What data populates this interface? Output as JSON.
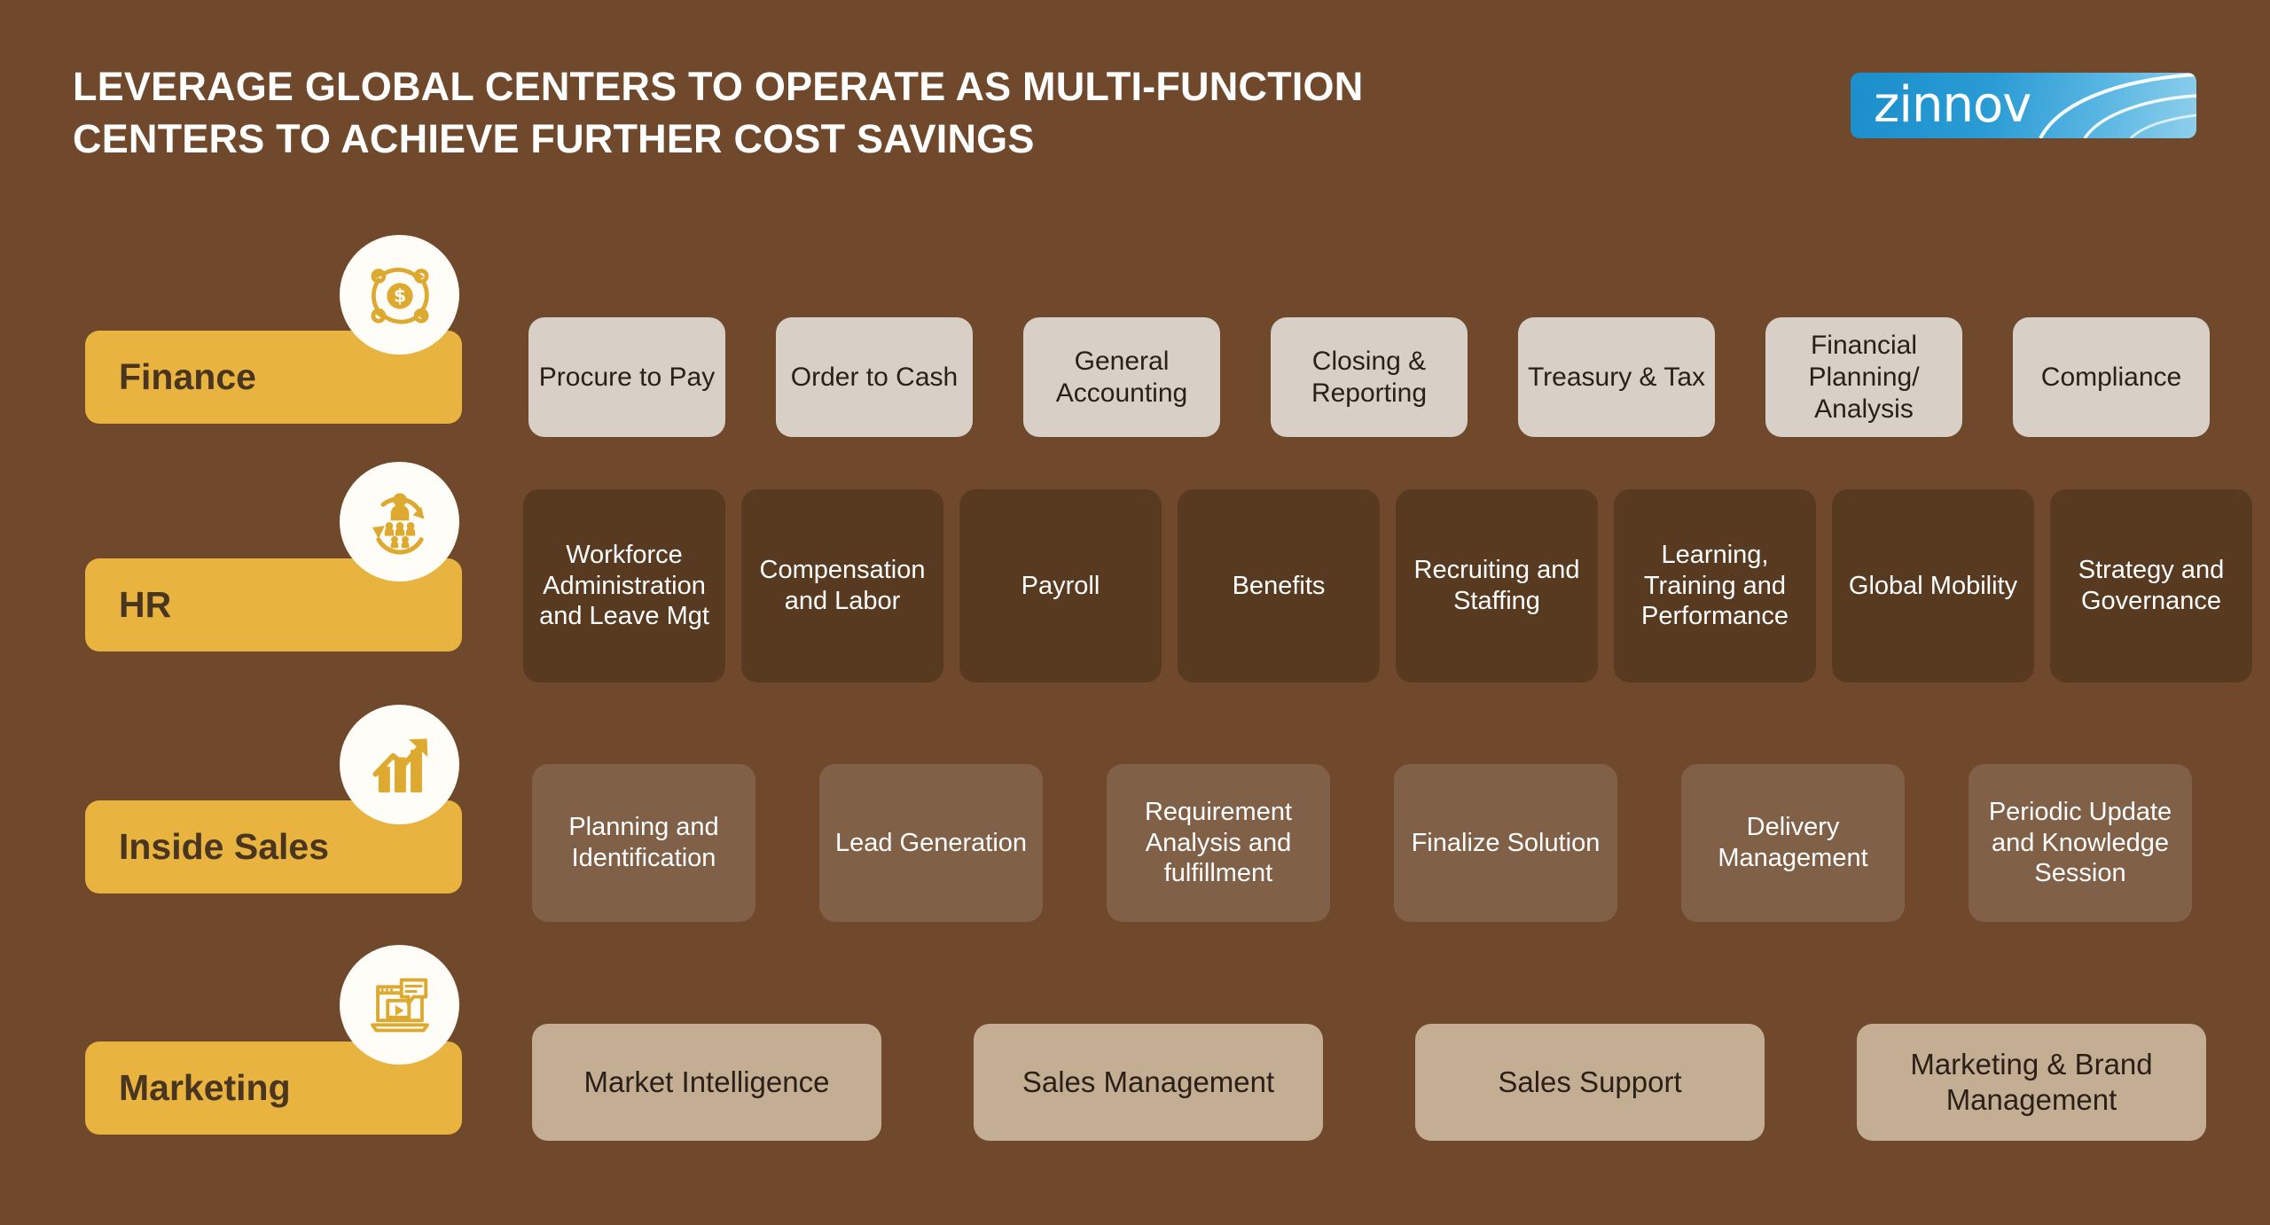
{
  "header": {
    "title_line1": "LEVERAGE GLOBAL CENTERS TO OPERATE AS MULTI-FUNCTION",
    "title_line2": "CENTERS TO ACHIEVE FURTHER COST SAVINGS",
    "logo_text": "zinnov"
  },
  "colors": {
    "background": "#70492C",
    "label_gold": "#E8B33E",
    "label_text": "#4A3520",
    "finance_box": "#D8CFC6",
    "hr_box": "#583A20",
    "sales_box": "#806047",
    "marketing_box": "#C4AE93",
    "logo_blue": "#2A9BD4",
    "icon_gold": "#DDA92F"
  },
  "rows": [
    {
      "label": "Finance",
      "icon": "money-cycle-icon",
      "items": [
        {
          "label": "Procure to Pay"
        },
        {
          "label": "Order to Cash"
        },
        {
          "label": "General Accounting"
        },
        {
          "label": "Closing & Reporting"
        },
        {
          "label": "Treasury & Tax"
        },
        {
          "label": "Financial Planning/ Analysis"
        },
        {
          "label": "Compliance"
        }
      ]
    },
    {
      "label": "HR",
      "icon": "people-cycle-icon",
      "items": [
        {
          "label": "Workforce Administration and Leave Mgt"
        },
        {
          "label": "Compensation and Labor"
        },
        {
          "label": "Payroll"
        },
        {
          "label": "Benefits"
        },
        {
          "label": "Recruiting and Staffing"
        },
        {
          "label": "Learning, Training and Performance"
        },
        {
          "label": "Global Mobility"
        },
        {
          "label": "Strategy and Governance"
        }
      ]
    },
    {
      "label": "Inside Sales",
      "icon": "growth-chart-icon",
      "items": [
        {
          "label": "Planning and Identification"
        },
        {
          "label": "Lead Generation"
        },
        {
          "label": "Requirement Analysis and fulfillment"
        },
        {
          "label": "Finalize Solution"
        },
        {
          "label": "Delivery Management"
        },
        {
          "label": "Periodic Update and Knowledge Session"
        }
      ]
    },
    {
      "label": "Marketing",
      "icon": "media-laptop-icon",
      "items": [
        {
          "label": "Market Intelligence"
        },
        {
          "label": "Sales Management"
        },
        {
          "label": "Sales Support"
        },
        {
          "label": "Marketing & Brand Management"
        }
      ]
    }
  ]
}
